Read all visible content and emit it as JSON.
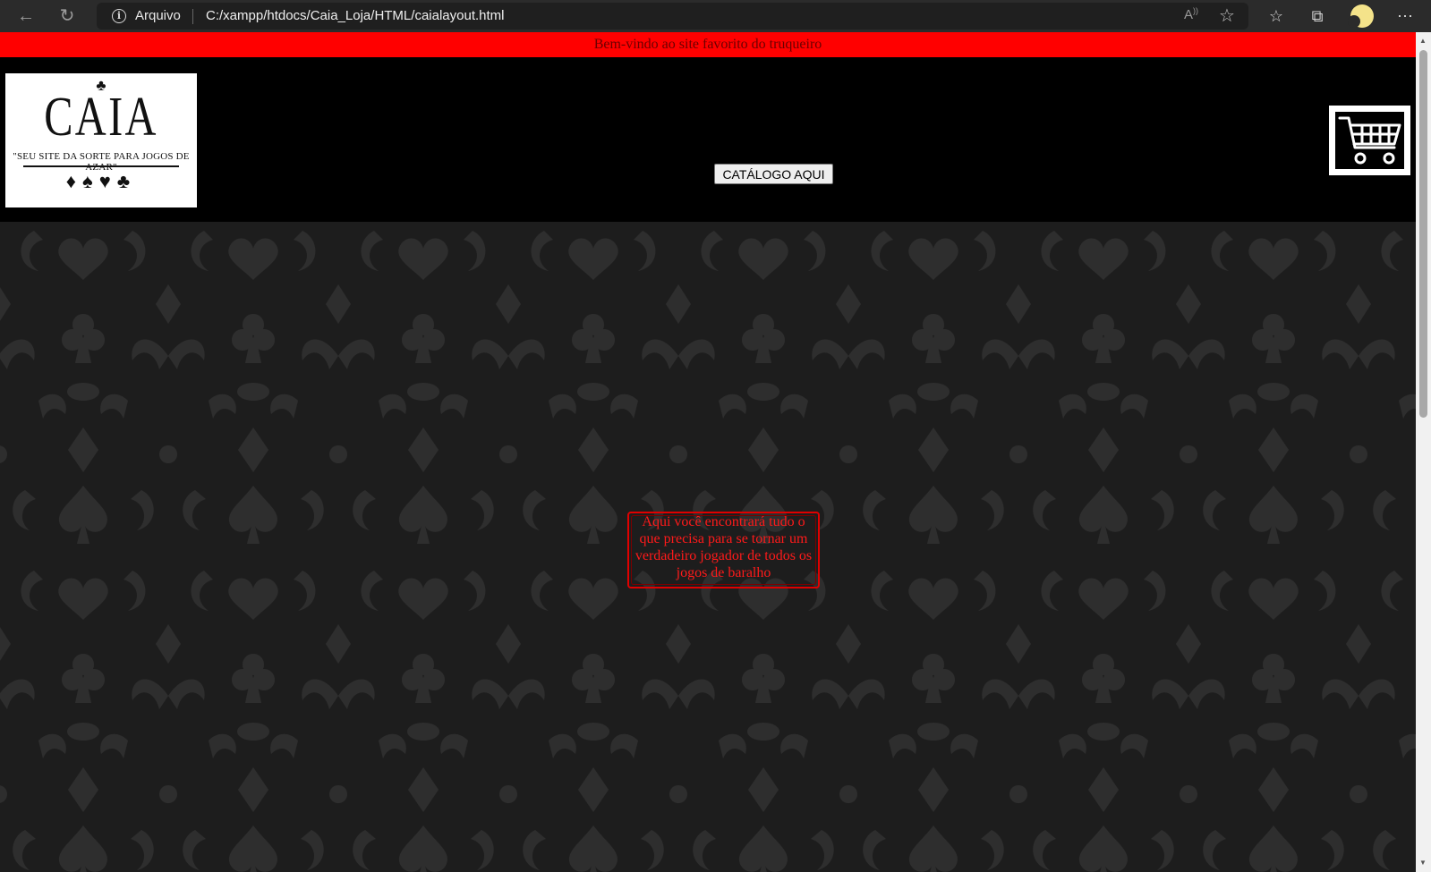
{
  "browser": {
    "scheme_label": "Arquivo",
    "url": "C:/xampp/htdocs/Caia_Loja/HTML/caialayout.html",
    "icons": [
      "back-icon",
      "refresh-icon",
      "info-icon",
      "read-aloud-icon",
      "add-favorite-icon",
      "favorites-icon",
      "collections-icon",
      "profile-icon",
      "more-icon"
    ]
  },
  "banner": {
    "text": "Bem-vindo ao site favorito do truqueiro"
  },
  "logo": {
    "title": "CAIA",
    "tagline": "\"SEU SITE DA SORTE PARA JOGOS DE AZAR\"",
    "top_suit": "♣",
    "suits": "♦♠♥♣"
  },
  "header": {
    "catalog_button": "CATÁLOGO AQUI"
  },
  "main": {
    "message": "Aqui você encontrará tudo o que precisa para se tornar um verdadeiro jogador de todos os jogos de baralho"
  },
  "colors": {
    "banner": "#ff0000",
    "message_text": "#ff1a1a",
    "header_bg": "#000000",
    "pattern_bg": "#1d1d1d",
    "pattern_fg": "#2e2e2e"
  }
}
